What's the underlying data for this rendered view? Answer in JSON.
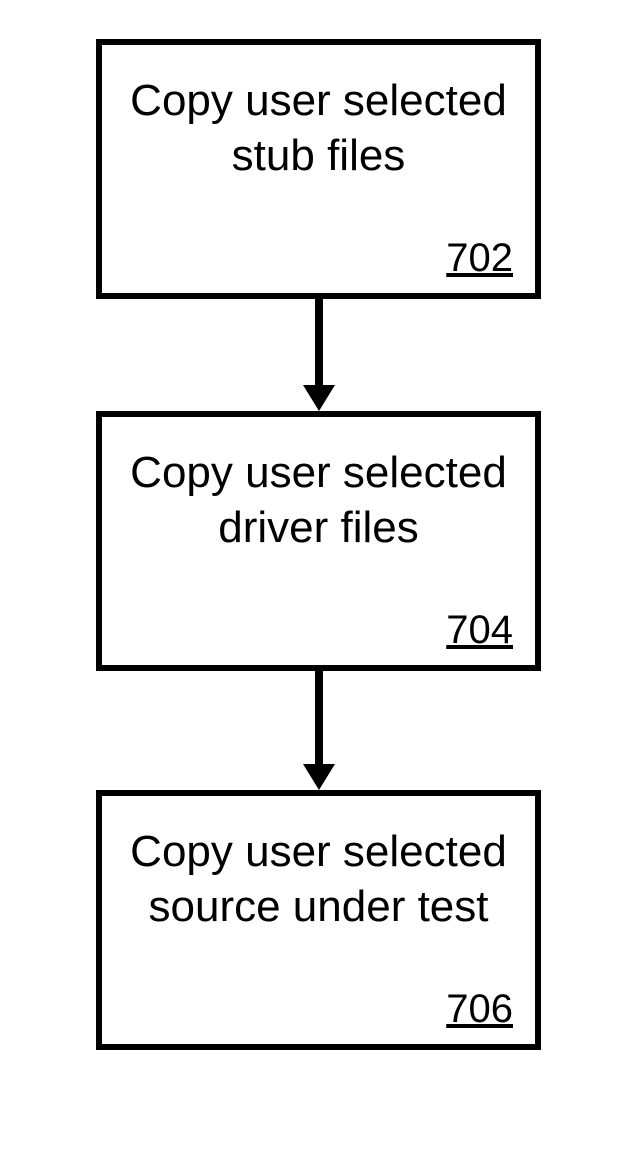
{
  "diagram": {
    "nodes": [
      {
        "text_line1": "Copy user selected",
        "text_line2": "stub files",
        "number": "702"
      },
      {
        "text_line1": "Copy user selected",
        "text_line2": "driver files",
        "number": "704"
      },
      {
        "text_line1": "Copy user selected",
        "text_line2": "source under test",
        "number": "706"
      }
    ]
  }
}
